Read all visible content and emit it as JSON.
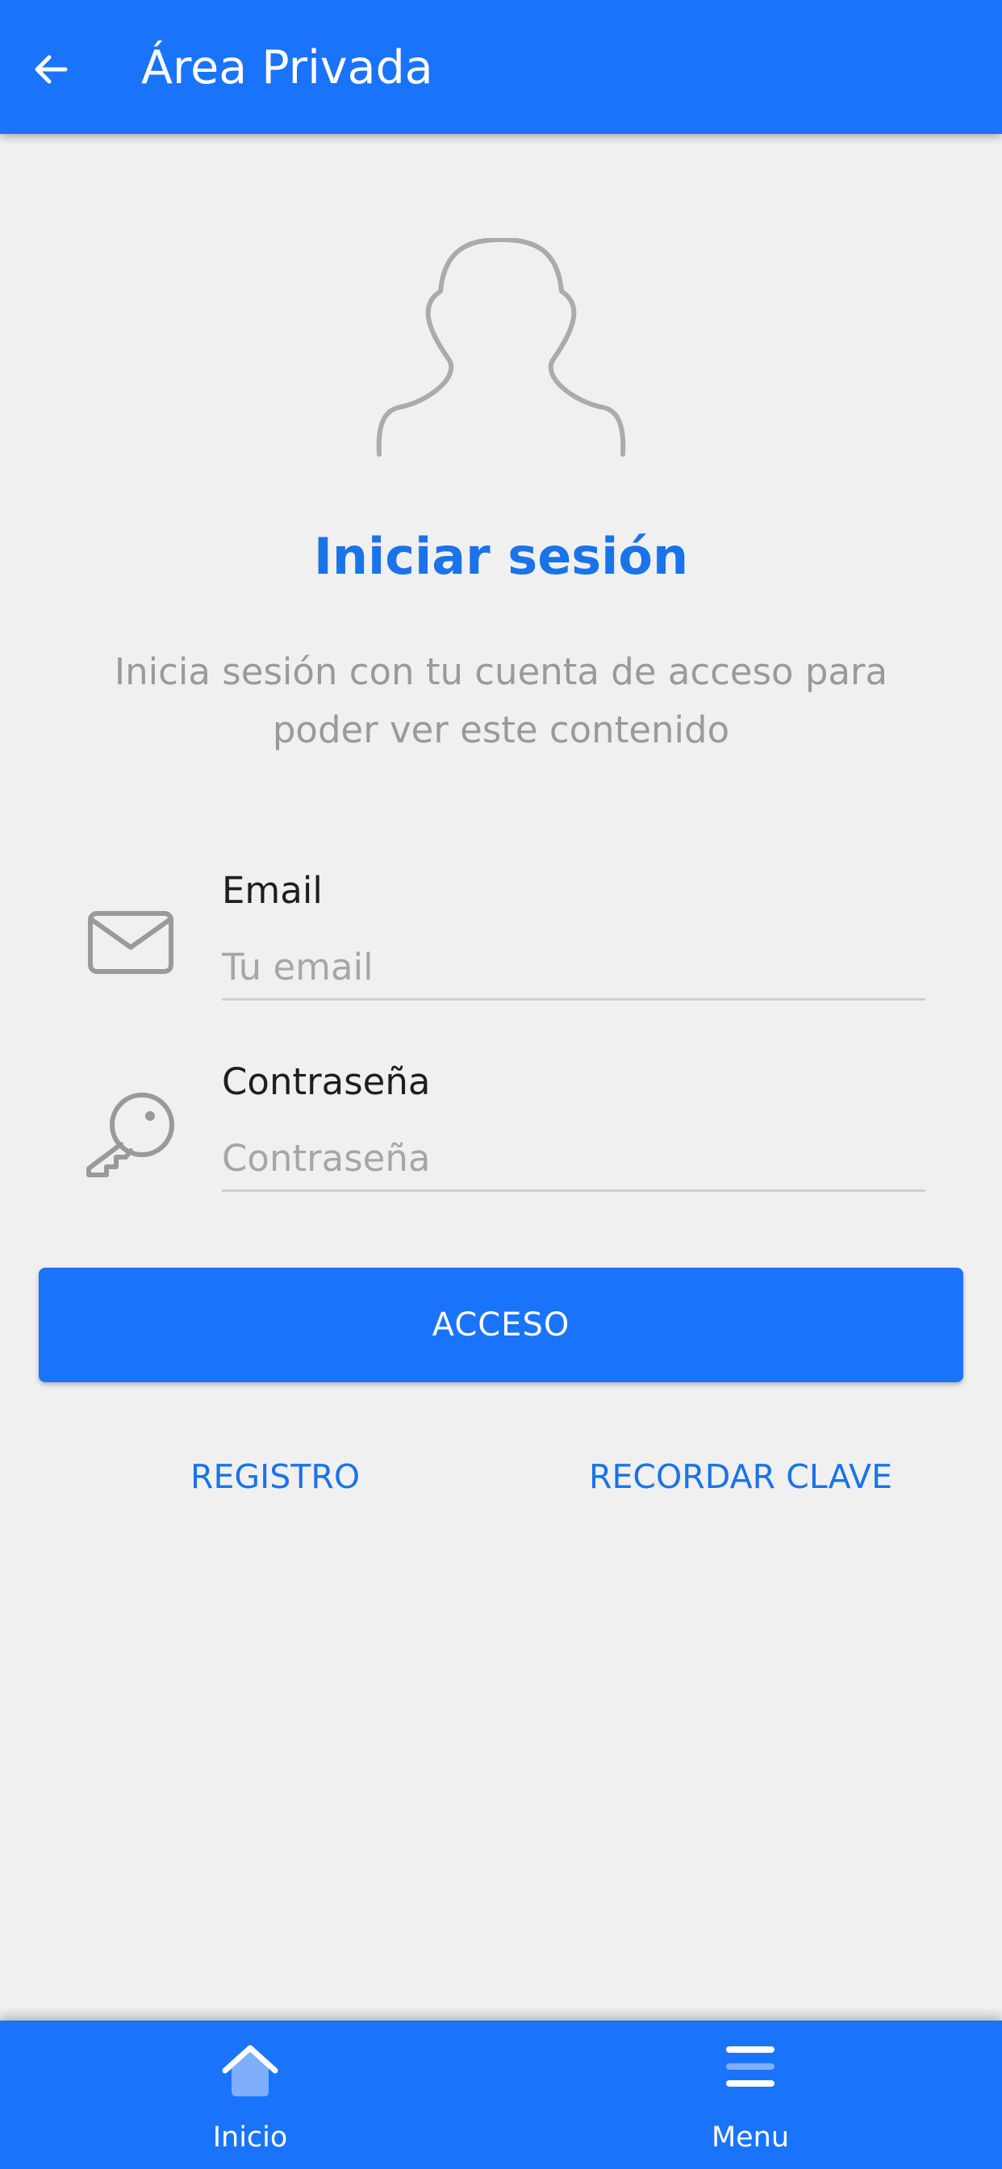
{
  "header": {
    "title": "Área Privada",
    "back_icon": "arrow-left-icon"
  },
  "login": {
    "avatar_icon": "user-silhouette-icon",
    "title": "Iniciar sesión",
    "description": "Inicia sesión con tu cuenta de acceso para poder ver este contenido"
  },
  "form": {
    "email": {
      "icon": "envelope-icon",
      "label": "Email",
      "placeholder": "Tu email",
      "value": ""
    },
    "password": {
      "icon": "key-icon",
      "label": "Contraseña",
      "placeholder": "Contraseña",
      "value": ""
    },
    "submit_label": "ACCESO"
  },
  "links": {
    "register": "REGISTRO",
    "remember_password": "RECORDAR CLAVE"
  },
  "bottom_nav": {
    "items": [
      {
        "label": "Inicio",
        "icon": "home-icon"
      },
      {
        "label": "Menu",
        "icon": "menu-icon"
      }
    ]
  },
  "colors": {
    "primary": "#1a73fb",
    "link": "#1a73e8",
    "background": "#f0f0f0",
    "muted_text": "#9a9a9a"
  }
}
